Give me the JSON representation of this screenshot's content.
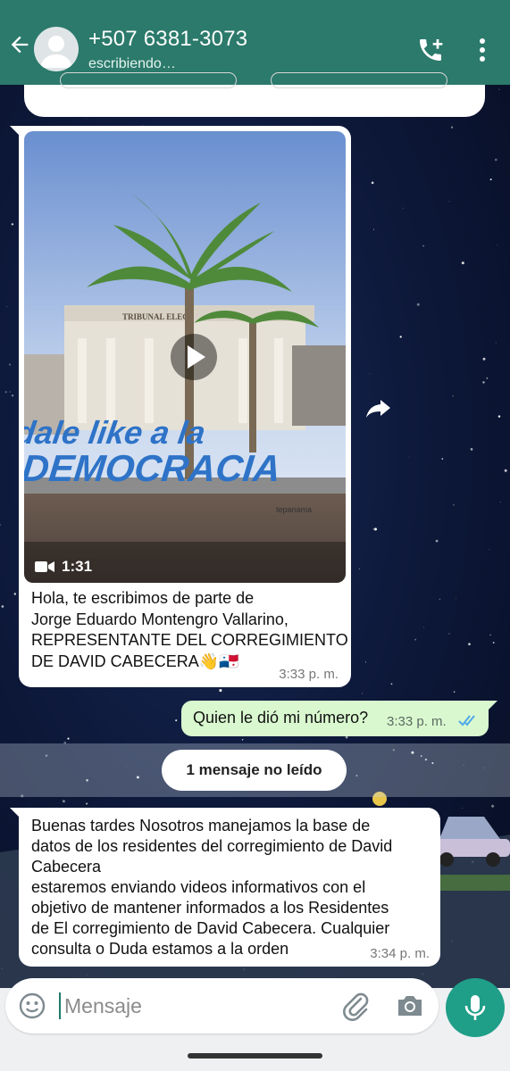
{
  "header": {
    "contact": "+507 6381-3073",
    "status": "escribiendo…",
    "icons": [
      "back-arrow-icon",
      "avatar",
      "add-call-icon",
      "more-vert-icon"
    ],
    "color": "#2b7a6b"
  },
  "video_message": {
    "duration": "1:31",
    "thumbnail_texts": [
      "TRIBUNAL ELEC",
      "#dale like a la",
      "#DEMOCRACIA",
      "tepanama"
    ],
    "caption_lines": [
      "Hola, te escribimos de parte de",
      "Jorge Eduardo Montengro Vallarino,",
      "REPRESENTANTE DEL CORREGIMIENTO",
      "DE DAVID CABECERA👋🇵🇦"
    ],
    "time": "3:33 p. m."
  },
  "outgoing_message": {
    "text": "Quien le dió mi número?",
    "time": "3:33 p. m.",
    "read_color": "#4fa8e8"
  },
  "unread_divider": "1 mensaje no leído",
  "incoming_message": {
    "lines": [
      "Buenas tardes Nosotros manejamos la base de",
      "datos de los residentes del corregimiento de David",
      "Cabecera",
      "estaremos enviando videos informativos con el",
      "objetivo de mantener informados a los Residentes",
      "de El corregimiento de David Cabecera. Cualquier",
      "consulta o Duda estamos a la orden"
    ],
    "time": "3:34 p. m."
  },
  "composer": {
    "placeholder": "Mensaje",
    "icons": [
      "emoji-icon",
      "attach-icon",
      "camera-icon",
      "mic-icon"
    ],
    "mic_color": "#1f9e88"
  }
}
